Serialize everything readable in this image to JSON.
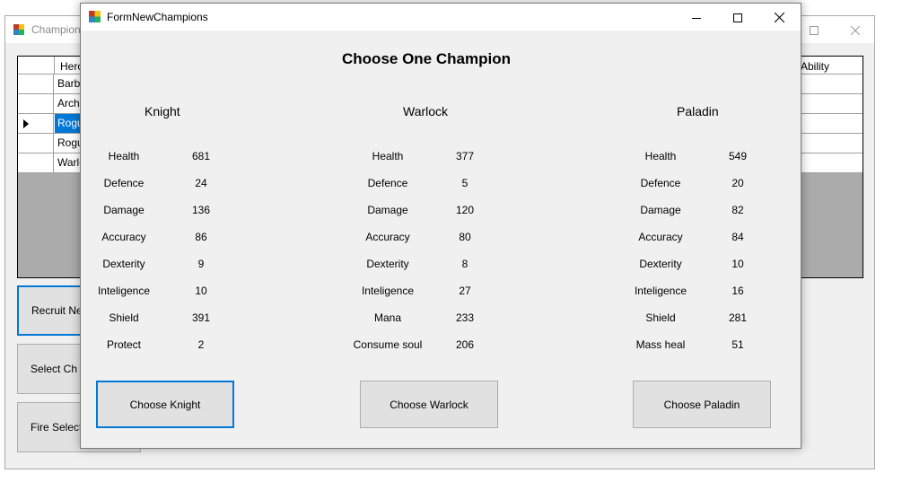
{
  "background_window": {
    "title": "Champion",
    "grid": {
      "columns": [
        "Hero",
        "Ability"
      ],
      "rows": [
        "Barba",
        "Arche",
        "Rogu",
        "Rogu",
        "Warlo"
      ],
      "selected_row_index": 2
    },
    "buttons": {
      "recruit": "Recruit New",
      "select": "Select Ch",
      "fire": "Fire Selected"
    }
  },
  "dialog": {
    "title": "FormNewChampions",
    "heading": "Choose One Champion",
    "champions": [
      {
        "name": "Knight",
        "stats": [
          {
            "label": "Health",
            "value": "681"
          },
          {
            "label": "Defence",
            "value": "24"
          },
          {
            "label": "Damage",
            "value": "136"
          },
          {
            "label": "Accuracy",
            "value": "86"
          },
          {
            "label": "Dexterity",
            "value": "9"
          },
          {
            "label": "Inteligence",
            "value": "10"
          },
          {
            "label": "Shield",
            "value": "391"
          },
          {
            "label": "Protect",
            "value": "2"
          }
        ],
        "button": "Choose Knight"
      },
      {
        "name": "Warlock",
        "stats": [
          {
            "label": "Health",
            "value": "377"
          },
          {
            "label": "Defence",
            "value": "5"
          },
          {
            "label": "Damage",
            "value": "120"
          },
          {
            "label": "Accuracy",
            "value": "80"
          },
          {
            "label": "Dexterity",
            "value": "8"
          },
          {
            "label": "Inteligence",
            "value": "27"
          },
          {
            "label": "Mana",
            "value": "233"
          },
          {
            "label": "Consume soul",
            "value": "206"
          }
        ],
        "button": "Choose Warlock"
      },
      {
        "name": "Paladin",
        "stats": [
          {
            "label": "Health",
            "value": "549"
          },
          {
            "label": "Defence",
            "value": "20"
          },
          {
            "label": "Damage",
            "value": "82"
          },
          {
            "label": "Accuracy",
            "value": "84"
          },
          {
            "label": "Dexterity",
            "value": "10"
          },
          {
            "label": "Inteligence",
            "value": "16"
          },
          {
            "label": "Shield",
            "value": "281"
          },
          {
            "label": "Mass heal",
            "value": "51"
          }
        ],
        "button": "Choose Paladin"
      }
    ]
  },
  "colors": {
    "accent": "#0078d7",
    "window_bg": "#f0f0f0",
    "button_bg": "#e1e1e1",
    "grid_bg": "#ababab"
  },
  "icons": {
    "app": "winforms-app-icon",
    "minimize": "minimize-icon",
    "maximize": "maximize-icon",
    "close": "close-icon"
  }
}
